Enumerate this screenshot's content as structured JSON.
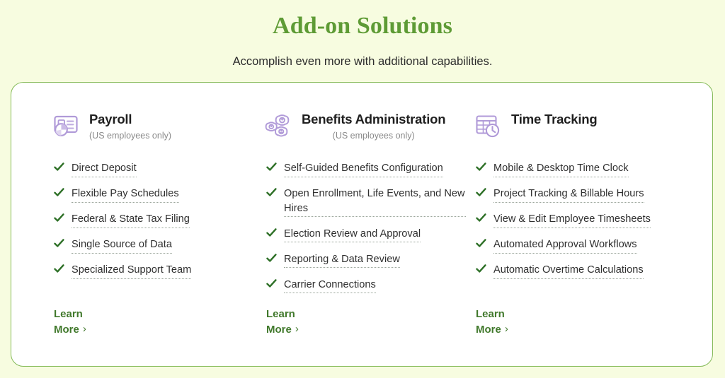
{
  "header": {
    "title": "Add-on Solutions",
    "subtitle": "Accomplish even more with additional capabilities."
  },
  "colors": {
    "page_background": "#f7fce0",
    "card_background": "#ffffff",
    "card_border": "#86bb5a",
    "title_green": "#5e9b35",
    "link_green": "#41792c",
    "check_green": "#2e7027",
    "icon_purple": "#b09ad8",
    "note_gray": "#8a8a8a",
    "body_text": "#2f2f2f"
  },
  "columns": [
    {
      "id": "payroll",
      "icon": "payroll-report-icon",
      "title": "Payroll",
      "note": "(US employees only)",
      "features": [
        "Direct Deposit",
        "Flexible Pay Schedules",
        "Federal & State Tax Filing",
        "Single Source of Data",
        "Specialized Support Team"
      ],
      "learn_more": {
        "line1": "Learn",
        "line2": "More",
        "chevron": "›"
      }
    },
    {
      "id": "benefits-administration",
      "icon": "benefits-flowers-icon",
      "title": "Benefits Administration",
      "note": "(US employees only)",
      "features": [
        "Self-Guided Benefits Configuration",
        "Open Enrollment, Life Events, and New Hires",
        "Election Review and Approval",
        "Reporting & Data Review",
        "Carrier Connections"
      ],
      "learn_more": {
        "line1": "Learn",
        "line2": "More",
        "chevron": "›"
      }
    },
    {
      "id": "time-tracking",
      "icon": "calendar-clock-icon",
      "title": "Time Tracking",
      "note": "",
      "features": [
        "Mobile & Desktop Time Clock",
        "Project Tracking & Billable Hours",
        "View & Edit Employee Timesheets",
        "Automated Approval Workflows",
        "Automatic Overtime Calculations"
      ],
      "learn_more": {
        "line1": "Learn",
        "line2": "More",
        "chevron": "›"
      }
    }
  ]
}
